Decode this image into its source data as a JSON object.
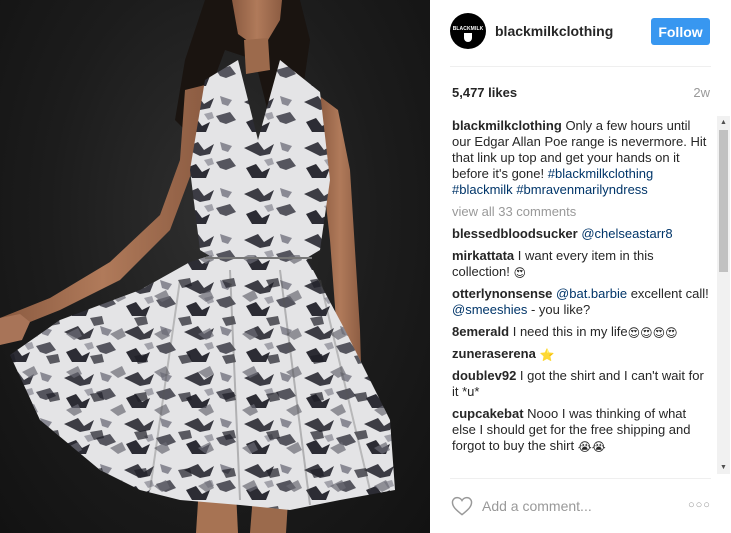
{
  "post": {
    "username": "blackmilkclothing",
    "avatar_text": "BLACKMILK",
    "follow_label": "Follow",
    "likes": "5,477 likes",
    "age": "2w",
    "caption": {
      "username": "blackmilkclothing",
      "text": "Only a few hours until our Edgar Allan Poe range is nevermore. Hit that link up top and get your hands on it before it's gone!",
      "hashtags": [
        "#blackmilkclothing",
        "#blackmilk",
        "#bmravenmarilyndress"
      ]
    },
    "view_all": "view all 33 comments",
    "comments": [
      {
        "user": "blessedbloodsucker",
        "mention": "@chelseastarr8"
      },
      {
        "user": "mirkattata",
        "text": "I want every item in this collection!",
        "emoji": "😍"
      },
      {
        "user": "otterlynonsense",
        "mention1": "@bat.barbie",
        "text1": "excellent call!",
        "mention2": "@smeeshies",
        "text2": "- you like?"
      },
      {
        "user": "8emerald",
        "text": "I need this in my life",
        "emoji": "😍😍😍😍"
      },
      {
        "user": "zuneraserena",
        "emoji": "⭐"
      },
      {
        "user": "doublev92",
        "text": "I got the shirt and I can't wait for it *u*"
      },
      {
        "user": "cupcakebat",
        "text": "Nooo I was thinking of what else I should get for the free shipping and forgot to buy the shirt",
        "emoji": "😭😭"
      }
    ],
    "add_comment_placeholder": "Add a comment...",
    "more_dots": "○○○"
  },
  "icons": {
    "heart": "heart-icon",
    "more": "more-options-icon",
    "scroll_up": "scroll-up-arrow-icon",
    "scroll_down": "scroll-down-arrow-icon"
  },
  "colors": {
    "follow": "#3897f0",
    "link": "#003569",
    "muted": "#999999",
    "photo_bg": "#1c1c1c"
  }
}
